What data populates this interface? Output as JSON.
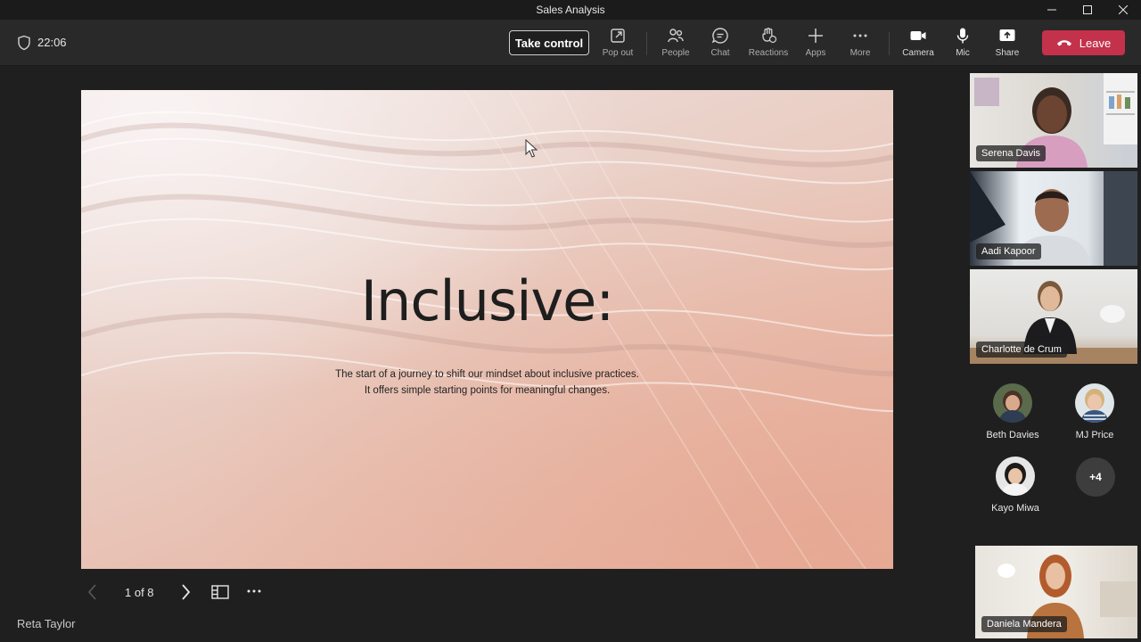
{
  "window": {
    "title": "Sales Analysis"
  },
  "toolbar": {
    "time": "22:06",
    "take_control": "Take control",
    "buttons": {
      "pop_out": "Pop out",
      "people": "People",
      "chat": "Chat",
      "reactions": "Reactions",
      "apps": "Apps",
      "more": "More",
      "camera": "Camera",
      "mic": "Mic",
      "share": "Share"
    },
    "leave": "Leave"
  },
  "slide": {
    "title": "Inclusive:",
    "line1": "The start of a journey to shift our mindset about inclusive practices.",
    "line2": "It offers simple starting points for meaningful changes."
  },
  "pager": {
    "text": "1 of 8"
  },
  "presenter": "Reta Taylor",
  "participants": {
    "video": [
      {
        "name": "Serena Davis"
      },
      {
        "name": "Aadi Kapoor"
      },
      {
        "name": "Charlotte de Crum"
      }
    ],
    "avatars": [
      {
        "name": "Beth Davies"
      },
      {
        "name": "MJ Price"
      },
      {
        "name": "Kayo Miwa"
      }
    ],
    "overflow": "+4",
    "self": {
      "name": "Daniela Mandera"
    }
  },
  "colors": {
    "leave": "#c4314b",
    "background": "#1f1f1f",
    "toolbar": "#292929"
  }
}
